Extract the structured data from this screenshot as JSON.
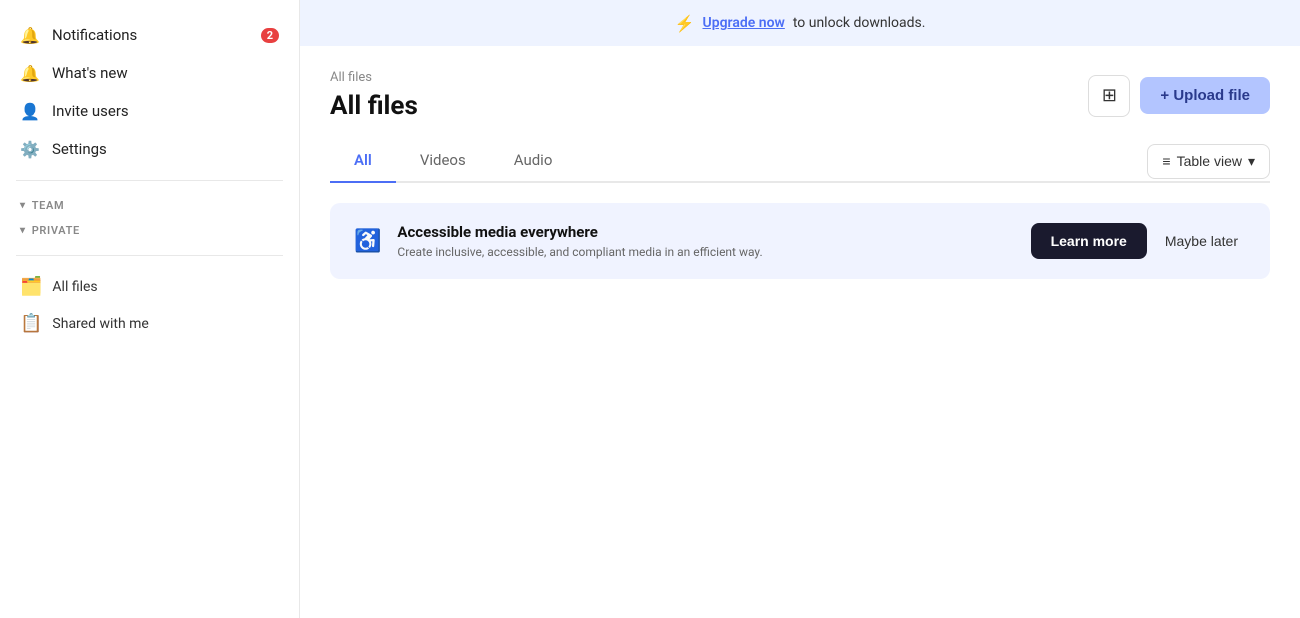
{
  "sidebar": {
    "nav": [
      {
        "id": "notifications",
        "label": "Notifications",
        "icon": "🔔",
        "badge": "2"
      },
      {
        "id": "whats-new",
        "label": "What's new",
        "icon": "🔔"
      },
      {
        "id": "invite-users",
        "label": "Invite users",
        "icon": "👤"
      },
      {
        "id": "settings",
        "label": "Settings",
        "icon": "⚙️"
      }
    ],
    "sections": [
      {
        "id": "team",
        "label": "TEAM"
      },
      {
        "id": "private",
        "label": "PRIVATE"
      }
    ],
    "folders": [
      {
        "id": "all-files",
        "label": "All files",
        "emoji": "🗂️"
      },
      {
        "id": "shared-with-me",
        "label": "Shared with me",
        "emoji": "📋"
      }
    ]
  },
  "banner": {
    "lightning": "⚡",
    "text_before": "Upgrade now",
    "text_after": " to unlock downloads."
  },
  "header": {
    "breadcrumb": "All files",
    "title": "All files",
    "add_icon": "➕",
    "upload_label": "+ Upload file"
  },
  "tabs": [
    {
      "id": "all",
      "label": "All",
      "active": true
    },
    {
      "id": "videos",
      "label": "Videos",
      "active": false
    },
    {
      "id": "audio",
      "label": "Audio",
      "active": false
    }
  ],
  "table_view": {
    "label": "Table view",
    "icon": "≡",
    "chevron": "▾"
  },
  "promo": {
    "icon": "♿",
    "title": "Accessible media everywhere",
    "description": "Create inclusive, accessible, and compliant media in an efficient way.",
    "learn_more_label": "Learn more",
    "maybe_later_label": "Maybe later"
  }
}
